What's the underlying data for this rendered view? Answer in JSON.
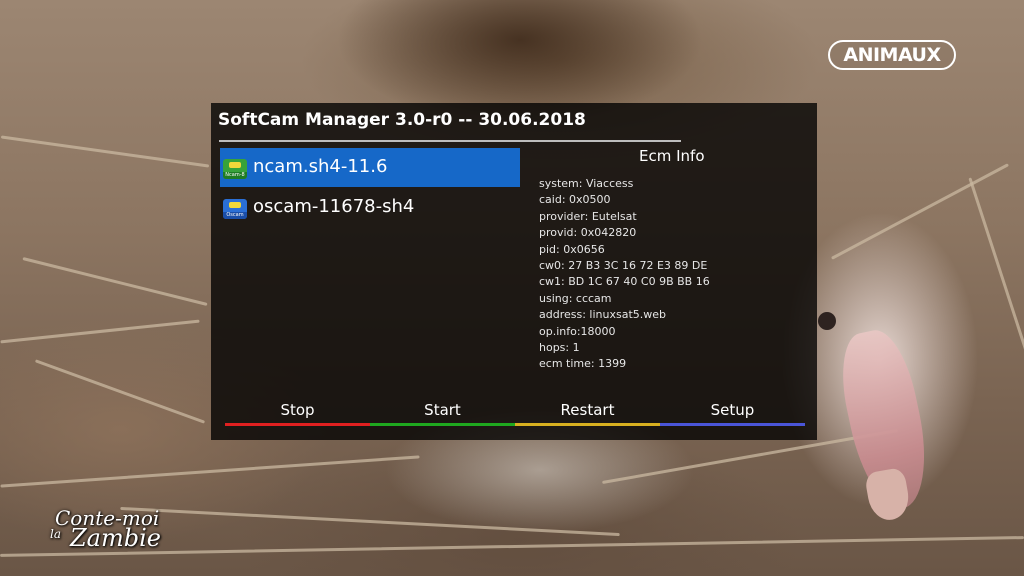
{
  "channel_logo": "ANIMAUX",
  "program_logo": {
    "line1": "Conte-moi",
    "line2": "la",
    "line3": "Zambie"
  },
  "panel": {
    "title": "SoftCam Manager 3.0-r0 -- 30.06.2018",
    "cams": [
      {
        "name": "ncam.sh4-11.6",
        "icon": "ncam-icon",
        "icon_text": "Ncam-8",
        "selected": true
      },
      {
        "name": "oscam-11678-sh4",
        "icon": "oscam-icon",
        "icon_text": "Oscam",
        "selected": false
      }
    ],
    "ecm": {
      "header": "Ecm Info",
      "lines": [
        "system: Viaccess",
        "caid: 0x0500",
        "provider: Eutelsat",
        "provid: 0x042820",
        "pid: 0x0656",
        "cw0: 27 B3 3C 16 72 E3 89 DE",
        "cw1: BD 1C 67 40 C0 9B BB 16",
        "using: cccam",
        "address: linuxsat5.web",
        "op.info:18000",
        "hops: 1",
        "ecm time: 1399"
      ]
    },
    "buttons": [
      {
        "label": "Stop",
        "color": "#e02020"
      },
      {
        "label": "Start",
        "color": "#1fa81f"
      },
      {
        "label": "Restart",
        "color": "#d8b020"
      },
      {
        "label": "Setup",
        "color": "#4a55d8"
      }
    ]
  }
}
